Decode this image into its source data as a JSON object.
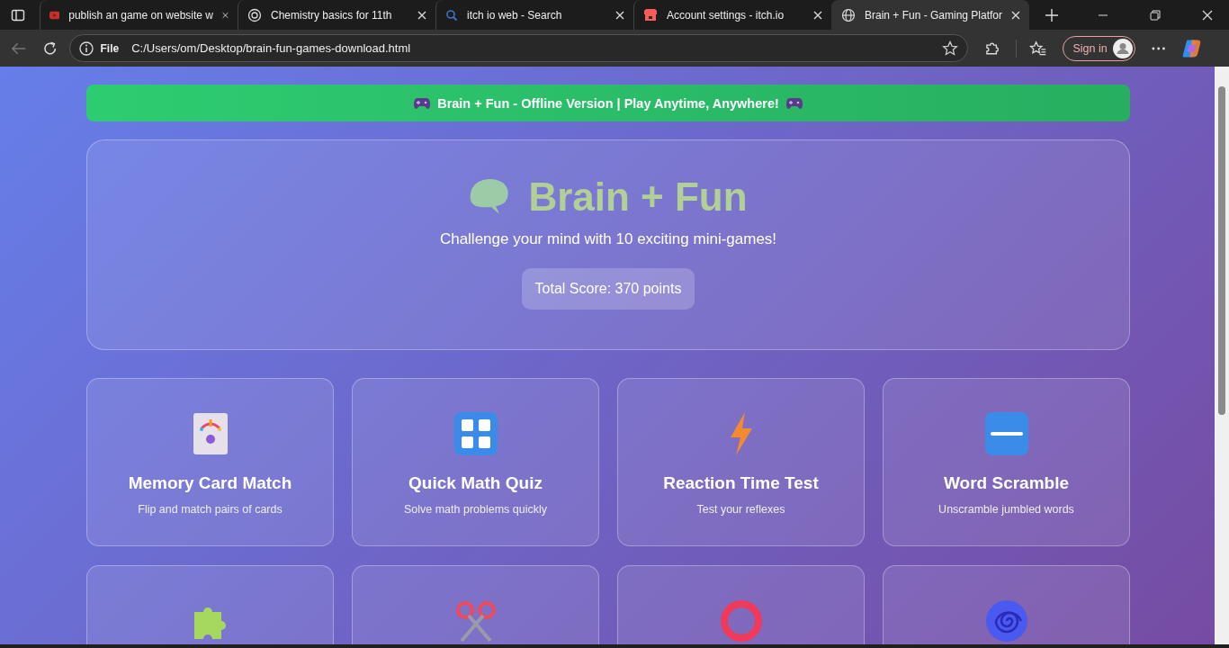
{
  "browser": {
    "tabs": [
      {
        "title": "publish an game on website w",
        "selected": false
      },
      {
        "title": "Chemistry basics for 11th",
        "selected": false
      },
      {
        "title": "itch io web - Search",
        "selected": false
      },
      {
        "title": "Account settings - itch.io",
        "selected": false
      },
      {
        "title": "Brain + Fun - Gaming Platfor",
        "selected": true
      }
    ],
    "address": {
      "scheme": "File",
      "url": "C:/Users/om/Desktop/brain-fun-games-download.html"
    },
    "sign_in": "Sign in"
  },
  "banner": "Brain + Fun - Offline Version | Play Anytime, Anywhere!",
  "header": {
    "title": "Brain + Fun",
    "subtitle": "Challenge your mind with 10 exciting mini-games!",
    "score": "Total Score: 370 points"
  },
  "games": [
    {
      "kind": "full",
      "title": "Memory Card Match",
      "description": "Flip and match pairs of cards"
    },
    {
      "kind": "full",
      "title": "Quick Math Quiz",
      "description": "Solve math problems quickly"
    },
    {
      "kind": "full",
      "title": "Reaction Time Test",
      "description": "Test your reflexes"
    },
    {
      "kind": "full",
      "title": "Word Scramble",
      "description": "Unscramble jumbled words"
    },
    {
      "kind": "cut_off"
    },
    {
      "kind": "cut_off"
    },
    {
      "kind": "cut_off"
    },
    {
      "kind": "cut_off"
    }
  ]
}
